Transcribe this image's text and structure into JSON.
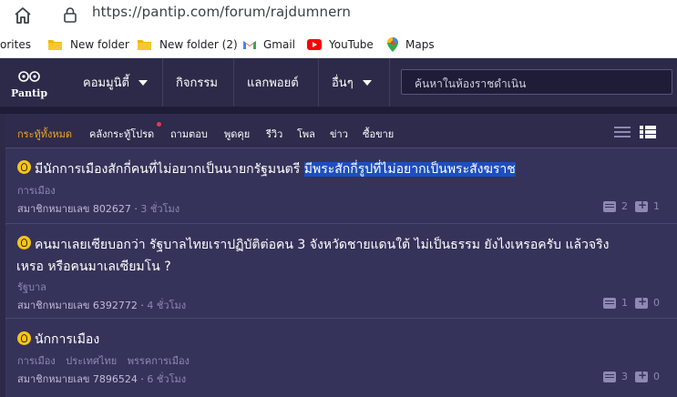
{
  "browser": {
    "url": "https://pantip.com/forum/rajdumnern",
    "bookmarks": [
      {
        "label": "orites",
        "icon": "none"
      },
      {
        "label": "New folder",
        "icon": "folder-icon"
      },
      {
        "label": "New folder (2)",
        "icon": "folder-icon"
      },
      {
        "label": "Gmail",
        "icon": "gmail-icon"
      },
      {
        "label": "YouTube",
        "icon": "youtube-icon"
      },
      {
        "label": "Maps",
        "icon": "maps-icon"
      }
    ]
  },
  "nav": {
    "logo": "Pantip",
    "items": [
      {
        "label": "คอมมูนิตี้",
        "caret": true
      },
      {
        "label": "กิจกรรม",
        "caret": false
      },
      {
        "label": "แลกพอยต์",
        "caret": false
      },
      {
        "label": "อื่นๆ",
        "caret": true
      }
    ],
    "search_placeholder": "ค้นหาในห้องราชดำเนิน"
  },
  "tabs": [
    {
      "label": "กระทู้ทั้งหมด",
      "active": true
    },
    {
      "label": "คลังกระทู้โปรด",
      "active": false,
      "dot": true
    },
    {
      "label": "ถามตอบ",
      "active": false
    },
    {
      "label": "พูดคุย",
      "active": false
    },
    {
      "label": "รีวิว",
      "active": false
    },
    {
      "label": "โพล",
      "active": false
    },
    {
      "label": "ข่าว",
      "active": false
    },
    {
      "label": "ซื้อขาย",
      "active": false
    }
  ],
  "posts": [
    {
      "title_plain": "มีนักการเมืองสักกี่คนที่ไม่อยากเป็นนายกรัฐมนตรี ",
      "title_highlight": "มีพระสักกี่รูปที่ไม่อยากเป็นพระสังฆราช",
      "tags": [
        "การเมือง"
      ],
      "author": "สมาชิกหมายเลข 802627",
      "time": "3 ชั่วโมง",
      "comments": "2",
      "votes": "1"
    },
    {
      "title_line1": "คนมาเลยเซียบอกว่า รัฐบาลไทยเราปฏิบัติต่อคน 3 จังหวัดชายแดนใต้ ไม่เป็นธรรม ยังไงเหรอครับ แล้วจริง",
      "title_line2": "เหรอ หรือคนมาเลเซียมโน ?",
      "tags": [
        "รัฐบาล"
      ],
      "author": "สมาชิกหมายเลข 6392772",
      "time": "4 ชั่วโมง",
      "comments": "1",
      "votes": "0"
    },
    {
      "title": "นักการเมือง",
      "tags": [
        "การเมือง",
        "ประเทศไทย",
        "พรรคการเมือง"
      ],
      "author": "สมาชิกหมายเลข 7896524",
      "time": "6 ชั่วโมง",
      "comments": "3",
      "votes": "0"
    }
  ]
}
